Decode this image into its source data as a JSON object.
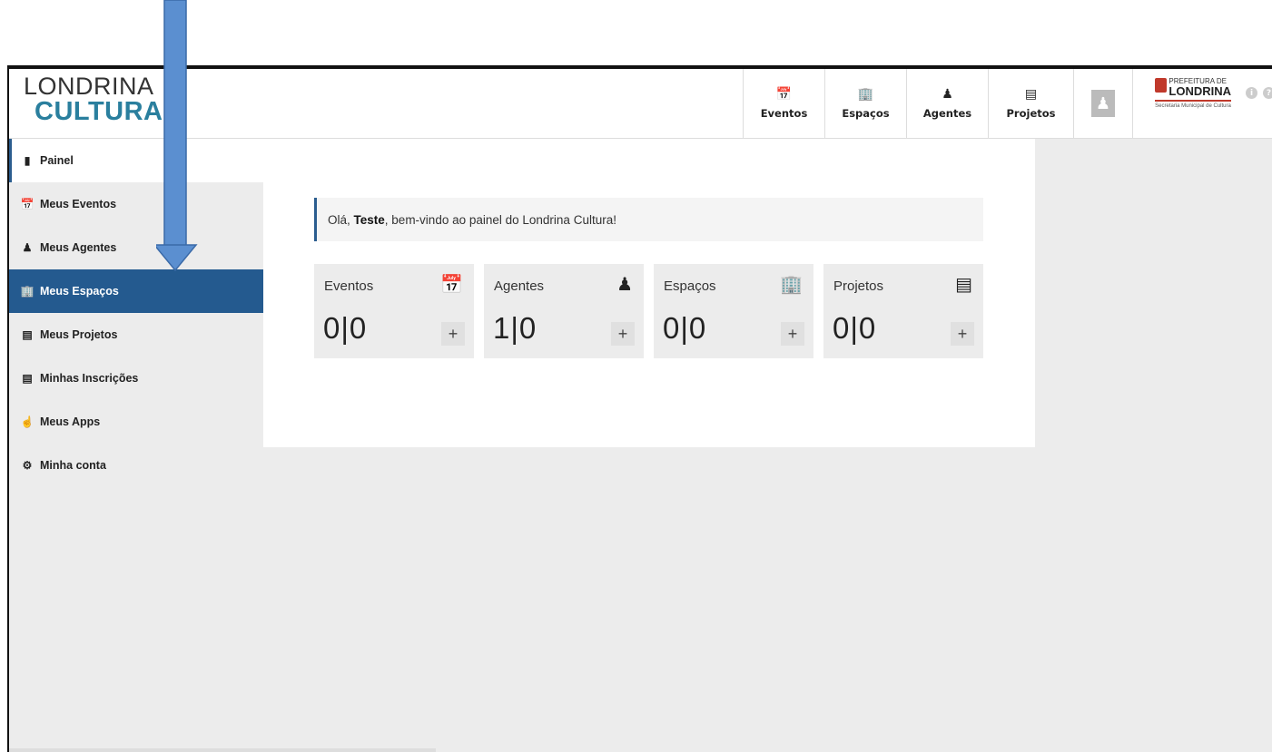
{
  "header": {
    "logo_line1": "LONDRINA",
    "logo_line2": "CULTURA",
    "nav": [
      {
        "label": "Eventos",
        "icon": "calendar-icon"
      },
      {
        "label": "Espaços",
        "icon": "building-icon"
      },
      {
        "label": "Agentes",
        "icon": "person-icon"
      },
      {
        "label": "Projetos",
        "icon": "document-icon"
      }
    ],
    "prefeitura_top": "PREFEITURA DE",
    "prefeitura_name": "LONDRINA",
    "prefeitura_sub": "Secretaria Municipal de Cultura"
  },
  "sidebar": {
    "items": [
      {
        "label": "Painel",
        "icon": "chart-icon"
      },
      {
        "label": "Meus Eventos",
        "icon": "calendar-icon"
      },
      {
        "label": "Meus Agentes",
        "icon": "person-icon"
      },
      {
        "label": "Meus Espaços",
        "icon": "building-icon"
      },
      {
        "label": "Meus Projetos",
        "icon": "document-icon"
      },
      {
        "label": "Minhas Inscrições",
        "icon": "document-icon"
      },
      {
        "label": "Meus Apps",
        "icon": "app-icon"
      },
      {
        "label": "Minha conta",
        "icon": "gear-icon"
      }
    ]
  },
  "welcome": {
    "greeting": "Olá, ",
    "name": "Teste",
    "message": ", bem-vindo ao painel do Londrina Cultura!"
  },
  "cards": [
    {
      "title": "Eventos",
      "count": "0|0",
      "icon": "calendar-icon",
      "add": "+"
    },
    {
      "title": "Agentes",
      "count": "1|0",
      "icon": "person-icon",
      "add": "+"
    },
    {
      "title": "Espaços",
      "count": "0|0",
      "icon": "building-icon",
      "add": "+"
    },
    {
      "title": "Projetos",
      "count": "0|0",
      "icon": "document-icon",
      "add": "+"
    }
  ],
  "colors": {
    "accent": "#245a8f",
    "logo_cultura": "#2a7f9e",
    "annotation_arrow": "#5b8fd0"
  }
}
